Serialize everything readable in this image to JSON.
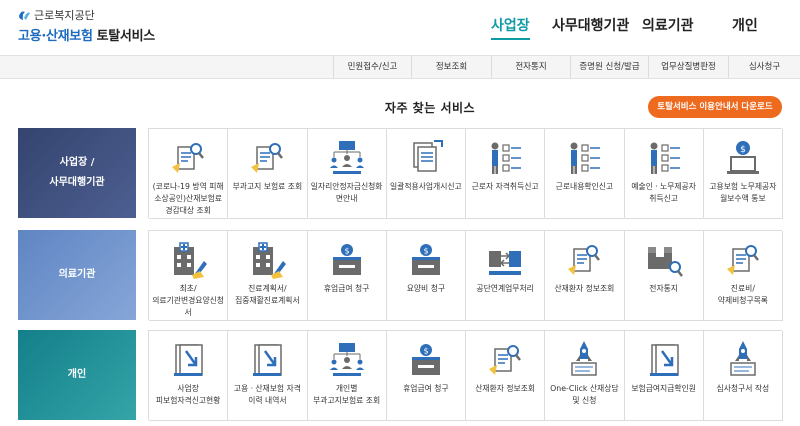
{
  "header": {
    "logo_org": "근로복지공단",
    "logo_service_a": "고용·산재보험",
    "logo_service_b": "토탈서비스"
  },
  "topnav": [
    {
      "label": "사업장",
      "active": true
    },
    {
      "label": "사무대행기관",
      "active": false
    },
    {
      "label": "의료기관",
      "active": false
    },
    {
      "label": "개인",
      "active": false
    }
  ],
  "subnav": [
    "민원접수/신고",
    "정보조회",
    "전자통지",
    "증명원 신청/발급",
    "업무상질병판정",
    "심사청구"
  ],
  "main": {
    "title": "자주 찾는 서비스",
    "download_label": "토탈서비스 이용안내서 다운로드"
  },
  "colors": {
    "accent": "#0f9aa5",
    "download": "#ee6a1f",
    "business_bg": "#3e4f7f",
    "medical_bg": "#6d91cb",
    "personal_bg": "#1f8f98",
    "icon_blue": "#2f6fb9",
    "icon_gray": "#6b6b6b",
    "icon_yellow": "#f2c23f"
  },
  "rows": [
    {
      "label_lines": [
        "사업장 /",
        "사무대행기관"
      ],
      "tiles": [
        {
          "icon": "document-magnifier-icon",
          "label": "(코로나-19 방역 피해 소상공인)산재보험료 경감대상 조회"
        },
        {
          "icon": "document-magnifier-icon",
          "label": "부과고지 보험료 조회"
        },
        {
          "icon": "people-network-icon",
          "label": "일자리안정자금신청화면안내"
        },
        {
          "icon": "document-stack-arrow-icon",
          "label": "일괄적용사업개시신고"
        },
        {
          "icon": "people-checklist-icon",
          "label": "근로자 자격취득신고"
        },
        {
          "icon": "people-checklist-icon",
          "label": "근로내용확인신고"
        },
        {
          "icon": "people-checklist-icon",
          "label": "예술인ㆍ노무제공자 취득신고"
        },
        {
          "icon": "money-laptop-icon",
          "label": "고용보험 노무제공자 월보수액 통보"
        }
      ]
    },
    {
      "label_lines": [
        "의료기관"
      ],
      "tiles": [
        {
          "icon": "hospital-pen-icon",
          "label": "최초/의료기관변경요양신청서"
        },
        {
          "icon": "hospital-pen-icon",
          "label": "진료계획서/집중재활진료계획서"
        },
        {
          "icon": "money-box-icon",
          "label": "휴업급여 청구"
        },
        {
          "icon": "money-box-icon",
          "label": "요양비 청구"
        },
        {
          "icon": "document-exchange-icon",
          "label": "공단연계업무처리"
        },
        {
          "icon": "document-magnifier-icon",
          "label": "산재환자 정보조회"
        },
        {
          "icon": "package-magnifier-icon",
          "label": "전자통지"
        },
        {
          "icon": "document-magnifier-icon",
          "label": "진료비/약제비청구목록"
        }
      ]
    },
    {
      "label_lines": [
        "개인"
      ],
      "tiles": [
        {
          "icon": "download-document-icon",
          "label": "사업장 피보험자격신고현황"
        },
        {
          "icon": "download-document-icon",
          "label": "고용ㆍ산재보험 자격 이력 내역서"
        },
        {
          "icon": "people-network-icon",
          "label": "개인별 부과고지보험료 조회"
        },
        {
          "icon": "money-box-icon",
          "label": "휴업급여 청구"
        },
        {
          "icon": "document-magnifier-icon",
          "label": "산재환자 정보조회"
        },
        {
          "icon": "rocket-document-icon",
          "label": "One-Click 산재상담 및 신청"
        },
        {
          "icon": "download-document-icon",
          "label": "보험급여지급확인원"
        },
        {
          "icon": "rocket-document-icon",
          "label": "심사청구서 작성"
        }
      ]
    }
  ]
}
